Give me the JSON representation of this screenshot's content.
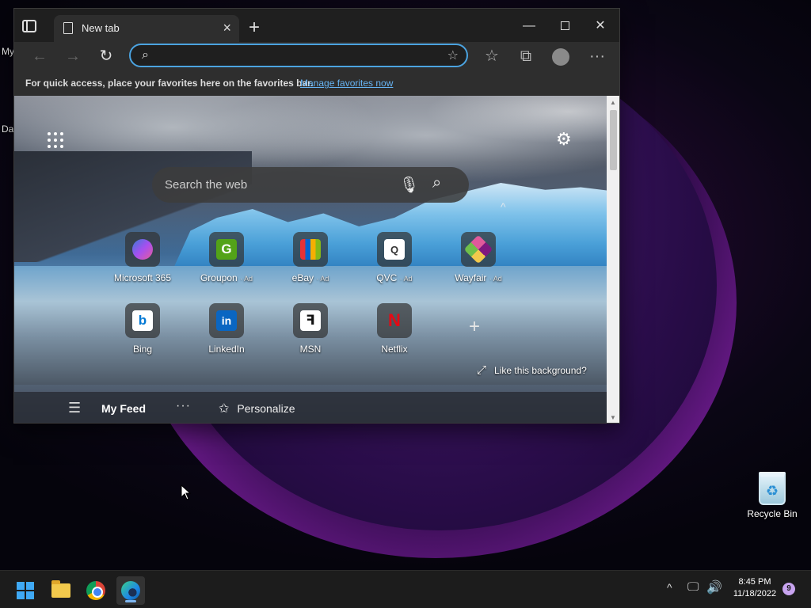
{
  "desktop": {
    "left_icon_1_label": "My",
    "left_icon_2_label": "Da",
    "recycle_bin_label": "Recycle Bin"
  },
  "browser": {
    "tab_title": "New tab",
    "new_tab_glyph": "+",
    "window_controls": {
      "minimize": "—",
      "close": "✕"
    },
    "address_bar": {
      "value": "",
      "placeholder": ""
    },
    "favorites_bar": {
      "message": "For quick access, place your favorites here on the favorites bar.",
      "manage_link": "Manage favorites now"
    },
    "new_tab_page": {
      "search_placeholder": "Search the web",
      "quick_links": [
        {
          "name": "Microsoft 365",
          "ad": "",
          "icon": "microsoft-365-icon",
          "color": "#7b5cf0"
        },
        {
          "name": "Groupon",
          "ad": "· Ad",
          "icon": "groupon-icon",
          "color": "#53a318"
        },
        {
          "name": "eBay",
          "ad": "· Ad",
          "icon": "ebay-icon",
          "color": "#e53238"
        },
        {
          "name": "QVC",
          "ad": "· Ad",
          "icon": "qvc-icon",
          "color": "#ffffff"
        },
        {
          "name": "Wayfair",
          "ad": "· Ad",
          "icon": "wayfair-icon",
          "color": "#7f187f"
        },
        {
          "name": "Bing",
          "ad": "",
          "icon": "bing-icon",
          "color": "#0078d4"
        },
        {
          "name": "LinkedIn",
          "ad": "",
          "icon": "linkedin-icon",
          "color": "#0a66c2"
        },
        {
          "name": "MSN",
          "ad": "",
          "icon": "msn-icon",
          "color": "#ffffff"
        },
        {
          "name": "Netflix",
          "ad": "",
          "icon": "netflix-icon",
          "color": "#e50914"
        }
      ],
      "like_background": "Like this background?",
      "feed": {
        "title": "My Feed",
        "more": "···",
        "personalize": "Personalize"
      }
    }
  },
  "taskbar": {
    "apps": [
      "start-icon",
      "file-explorer-icon",
      "chrome-icon",
      "edge-icon"
    ],
    "clock_time": "8:45 PM",
    "clock_date": "11/18/2022",
    "notification_count": "9"
  }
}
